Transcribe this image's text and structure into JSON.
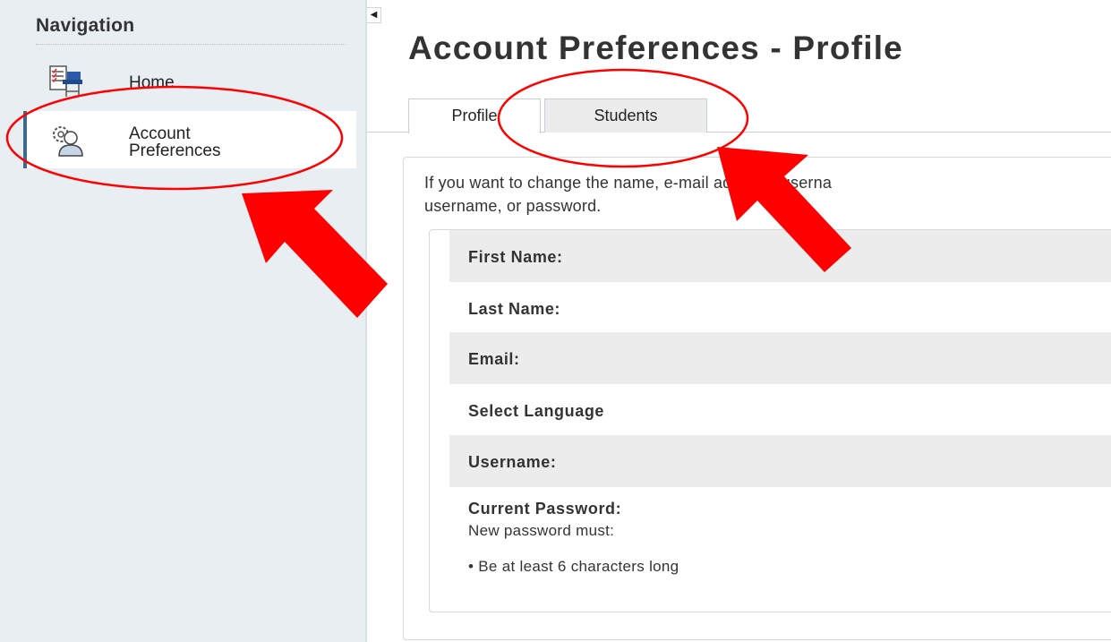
{
  "sidebar": {
    "title": "Navigation",
    "collapse_glyph": "◀",
    "items": [
      {
        "label": "Home",
        "icon": "checklist-board-icon",
        "active": false
      },
      {
        "label_line1": "Account",
        "label_line2": "Preferences",
        "icon": "gear-user-icon",
        "active": true
      }
    ]
  },
  "page": {
    "title": "Account Preferences - Profile",
    "tabs": [
      {
        "label": "Profile",
        "active": true
      },
      {
        "label": "Students",
        "active": false
      }
    ],
    "intro_line1": "If you want to change the name, e-mail address, userna",
    "intro_line2": "username, or password.",
    "fields": [
      {
        "label": "First Name:"
      },
      {
        "label": "Last Name:"
      },
      {
        "label": "Email:"
      },
      {
        "label": "Select Language"
      },
      {
        "label": "Username:"
      }
    ],
    "password": {
      "label": "Current Password:",
      "hint": "New password must:",
      "rule": "• Be at least 6 characters long"
    }
  },
  "annotation_color": "#ff0000"
}
